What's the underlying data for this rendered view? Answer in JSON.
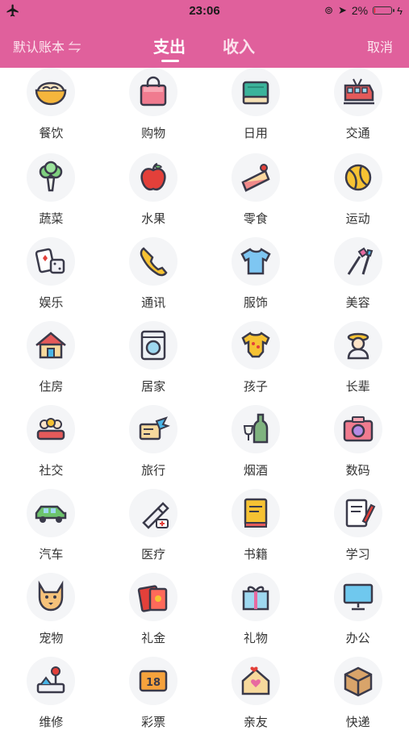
{
  "status_bar": {
    "time": "23:06",
    "battery_percent": "2%",
    "battery_level": 0.02
  },
  "nav": {
    "account_label": "默认账本 ⇋",
    "tab_expense": "支出",
    "tab_income": "收入",
    "cancel_label": "取消",
    "accent_color": "#e0609c"
  },
  "categories": [
    {
      "label": "餐饮",
      "icon": "bowl-icon"
    },
    {
      "label": "购物",
      "icon": "shopping-bag-icon"
    },
    {
      "label": "日用",
      "icon": "towel-icon"
    },
    {
      "label": "交通",
      "icon": "train-icon"
    },
    {
      "label": "蔬菜",
      "icon": "vegetable-icon"
    },
    {
      "label": "水果",
      "icon": "apple-icon"
    },
    {
      "label": "零食",
      "icon": "cake-icon"
    },
    {
      "label": "运动",
      "icon": "ball-icon"
    },
    {
      "label": "娱乐",
      "icon": "cards-dice-icon"
    },
    {
      "label": "通讯",
      "icon": "phone-icon"
    },
    {
      "label": "服饰",
      "icon": "tshirt-icon"
    },
    {
      "label": "美容",
      "icon": "makeup-icon"
    },
    {
      "label": "住房",
      "icon": "house-icon"
    },
    {
      "label": "居家",
      "icon": "washing-machine-icon"
    },
    {
      "label": "孩子",
      "icon": "baby-onesie-icon"
    },
    {
      "label": "长辈",
      "icon": "elder-icon"
    },
    {
      "label": "社交",
      "icon": "people-icon"
    },
    {
      "label": "旅行",
      "icon": "plane-ticket-icon"
    },
    {
      "label": "烟酒",
      "icon": "wine-icon"
    },
    {
      "label": "数码",
      "icon": "camera-icon"
    },
    {
      "label": "汽车",
      "icon": "car-icon"
    },
    {
      "label": "医疗",
      "icon": "syringe-icon"
    },
    {
      "label": "书籍",
      "icon": "book-icon"
    },
    {
      "label": "学习",
      "icon": "notebook-pen-icon"
    },
    {
      "label": "宠物",
      "icon": "dog-icon"
    },
    {
      "label": "礼金",
      "icon": "red-envelope-icon"
    },
    {
      "label": "礼物",
      "icon": "gift-icon"
    },
    {
      "label": "办公",
      "icon": "monitor-icon"
    },
    {
      "label": "维修",
      "icon": "repair-icon"
    },
    {
      "label": "彩票",
      "icon": "lottery-icon"
    },
    {
      "label": "亲友",
      "icon": "family-house-icon"
    },
    {
      "label": "快递",
      "icon": "package-icon"
    }
  ]
}
